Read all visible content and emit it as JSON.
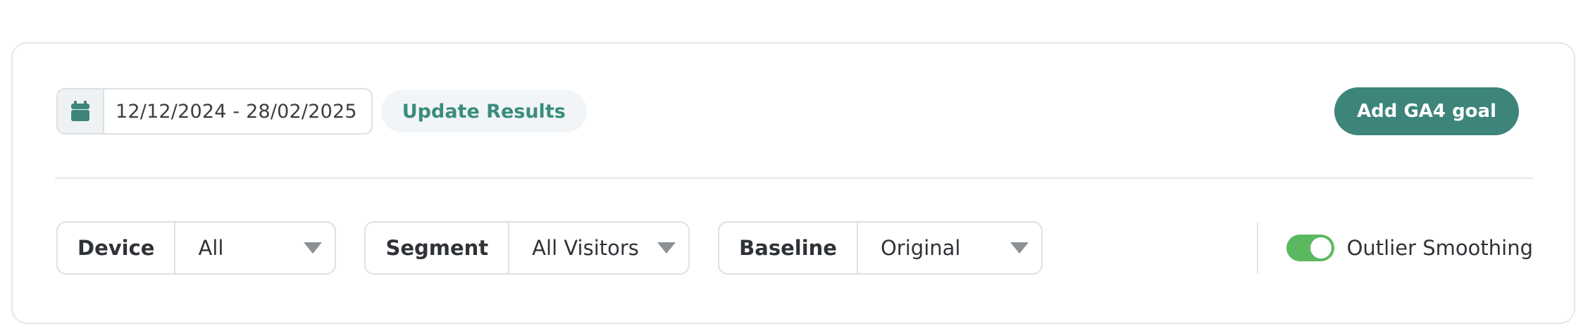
{
  "date_range": {
    "value": "12/12/2024 - 28/02/2025",
    "icon": "calendar-icon"
  },
  "update_button": {
    "label": "Update Results"
  },
  "ga4_button": {
    "label": "Add GA4 goal"
  },
  "filters": {
    "device": {
      "label": "Device",
      "value": "All"
    },
    "segment": {
      "label": "Segment",
      "value": "All Visitors"
    },
    "baseline": {
      "label": "Baseline",
      "value": "Original"
    }
  },
  "outlier_smoothing": {
    "label": "Outlier Smoothing",
    "enabled": true
  },
  "colors": {
    "accent": "#3d857a",
    "accent_text": "#3a8c7c",
    "toggle_on": "#5cb860"
  }
}
